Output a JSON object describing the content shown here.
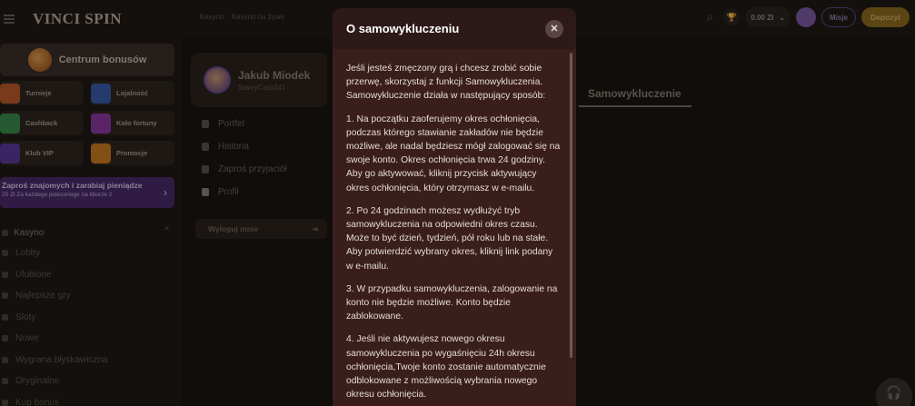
{
  "sidebar": {
    "logo": "VINCI SPIN",
    "bonus_center": "Centrum bonusów",
    "tiles": [
      {
        "label": "Turnieje",
        "color": "#b85a2a"
      },
      {
        "label": "Lojalność",
        "color": "#3a5aa8"
      },
      {
        "label": "Cashback",
        "color": "#3a8a4a"
      },
      {
        "label": "Koło fortuny",
        "color": "#8a3aa0"
      },
      {
        "label": "Klub VIP",
        "color": "#5a3a9a"
      },
      {
        "label": "Promocje",
        "color": "#c87a20"
      }
    ],
    "referral": {
      "title": "Zaproś znajomych i zarabiaj pieniądze",
      "sub": "20 Zł Za każdego poleconego na tiborze 2",
      "arrow": "›"
    },
    "casino_section": "Kasyno",
    "casino_chevron": "^",
    "items": [
      "Lobby",
      "Ulubione",
      "Najlepsze gry",
      "Sloty",
      "Nowe",
      "Wygrana błyskawiczna",
      "Oryginalne",
      "Kup bonus"
    ]
  },
  "topbar": {
    "tab_casino": "Kasyno",
    "tab_live": "Kasyno na żywo",
    "search_icon": "⌕",
    "trophy_icon": "🏆",
    "balance": "0.00 Zł",
    "balance_caret": "⌄",
    "missions": "Misje",
    "deposit": "Depozyt"
  },
  "profile": {
    "name": "Jakub Miodek",
    "username": "SavvyCarp241",
    "nav": [
      "Portfel",
      "Historia",
      "Zaproś przyjaciół",
      "Profil"
    ],
    "logout": "Wyloguj mnie",
    "logout_icon": "⇥",
    "active_tab": "Samowykluczenie"
  },
  "modal": {
    "title": "O samowykluczeniu",
    "close_icon": "✕",
    "paragraphs": [
      "Jeśli jesteś zmęczony grą i chcesz zrobić sobie przerwę, skorzystaj z funkcji Samowykluczenia. Samowykluczenie działa w następujący sposób:",
      "1. Na początku zaoferujemy okres ochłonięcia, podczas którego stawianie zakładów nie będzie możliwe, ale nadal będziesz mógł zalogować się na swoje konto. Okres ochłonięcia trwa 24 godziny. Aby go aktywować, kliknij przycisk aktywujący okres ochłonięcia, który otrzymasz w e-mailu.",
      "2. Po 24 godzinach możesz wydłużyć tryb samowykluczenia na odpowiedni okres czasu. Może to być dzień, tydzień, pół roku lub na stałe. Aby potwierdzić wybrany okres, kliknij link podany w e-mailu.",
      "3. W przypadku samowykluczenia, zalogowanie na konto nie będzie możliwe. Konto będzie zablokowane.",
      "4. Jeśli nie aktywujesz nowego okresu samowykluczenia po wygaśnięciu 24h okresu ochłonięcia,Twoje konto zostanie automatycznie odblokowane z możliwością wybrania nowego okresu ochłonięcia."
    ]
  },
  "support_icon": "🎧"
}
